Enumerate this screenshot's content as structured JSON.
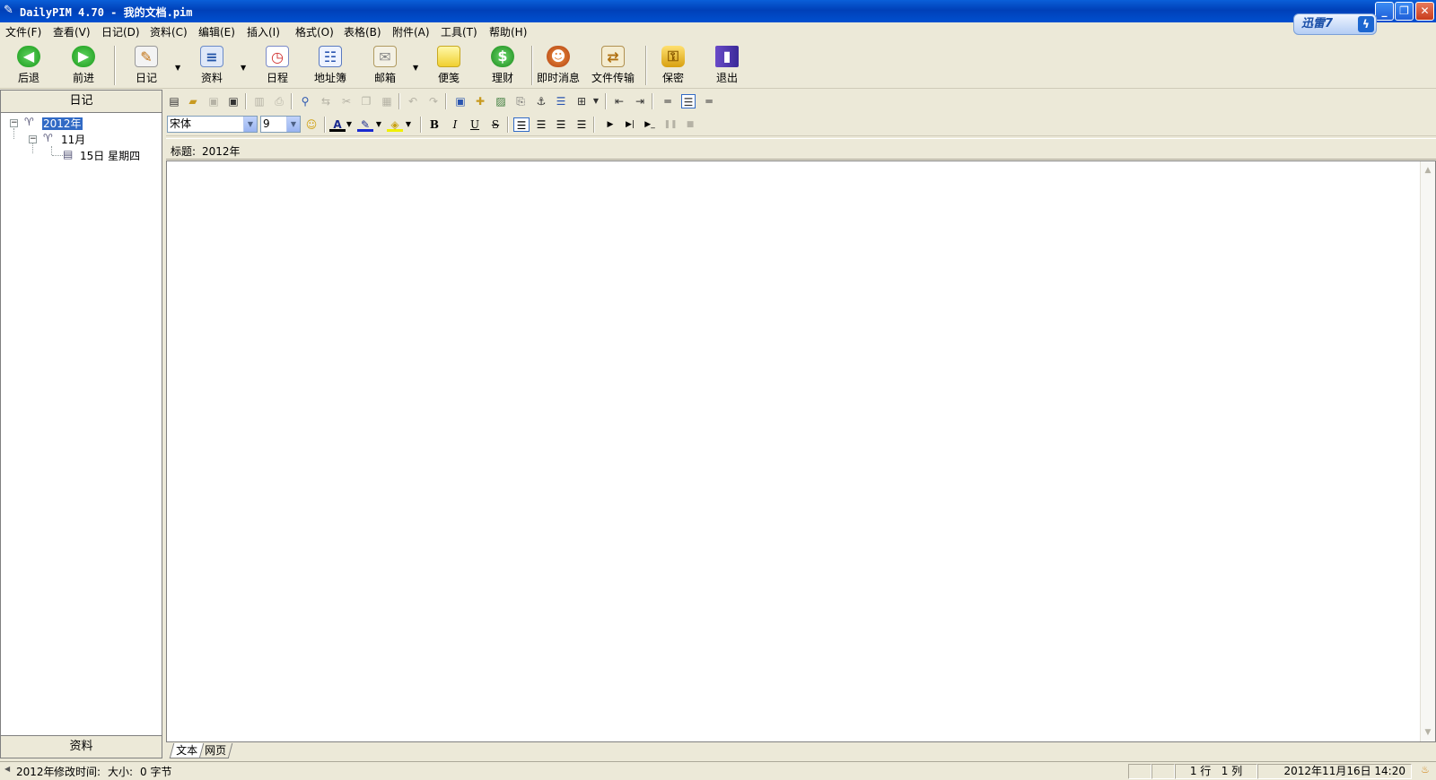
{
  "window": {
    "title": "DailyPIM 4.70 - 我的文档.pim",
    "minimize": "_",
    "restore": "❐",
    "close": "✕"
  },
  "xunlei": {
    "label": "迅雷7",
    "bolt": "ϟ"
  },
  "menu": [
    "文件(F)",
    "查看(V)",
    "日记(D)",
    "资料(C)",
    "编辑(E)",
    "插入(I)",
    "格式(O)",
    "表格(B)",
    "附件(A)",
    "工具(T)",
    "帮助(H)"
  ],
  "toolbar": {
    "back": "后退",
    "forward": "前进",
    "diary": "日记",
    "info": "资料",
    "schedule": "日程",
    "address": "地址簿",
    "mail": "邮箱",
    "note": "便笺",
    "finance": "理财",
    "im": "即时消息",
    "filetransfer": "文件传输",
    "secure": "保密",
    "exit": "退出"
  },
  "sidebar": {
    "header": "日记",
    "footer": "资料",
    "tree": {
      "year": "2012年",
      "month": "11月",
      "day": "15日 星期四"
    }
  },
  "format": {
    "font": "宋体",
    "size": "9"
  },
  "subject": {
    "label": "标题:",
    "value": "2012年"
  },
  "viewtabs": [
    "文本",
    "网页"
  ],
  "status": {
    "doc": "2012年",
    "modified_label": "修改时间:",
    "size_label": "大小:",
    "size_value": "0 字节",
    "line": "1 行",
    "col": "1 列",
    "datetime": "2012年11月16日 14:20"
  }
}
